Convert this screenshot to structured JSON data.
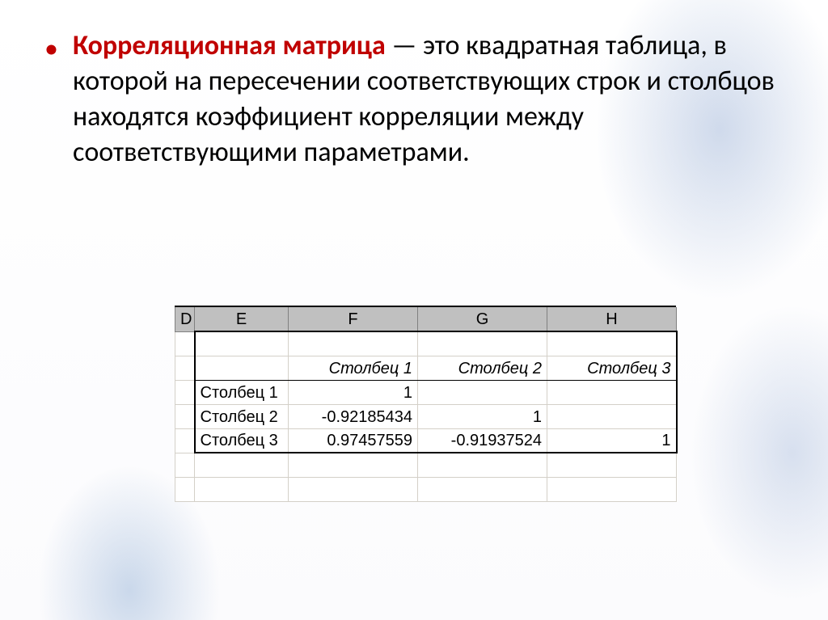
{
  "bullet": {
    "term": "Корреляционная матрица",
    "rest": " — это квадратная таблица, в которой на пересечении соответствующих строк и столбцов находятся коэффициент корреляции между соответствующими параметрами."
  },
  "sheet": {
    "columns": {
      "D": "D",
      "E": "E",
      "F": "F",
      "G": "G",
      "H": "H"
    },
    "headers": {
      "col1": "Столбец 1",
      "col2": "Столбец 2",
      "col3": "Столбец 3"
    },
    "rows": [
      {
        "label": "Столбец 1",
        "c1": "1",
        "c2": "",
        "c3": ""
      },
      {
        "label": "Столбец 2",
        "c1": "-0.92185434",
        "c2": "1",
        "c3": ""
      },
      {
        "label": "Столбец 3",
        "c1": "0.97457559",
        "c2": "-0.91937524",
        "c3": "1"
      }
    ]
  }
}
